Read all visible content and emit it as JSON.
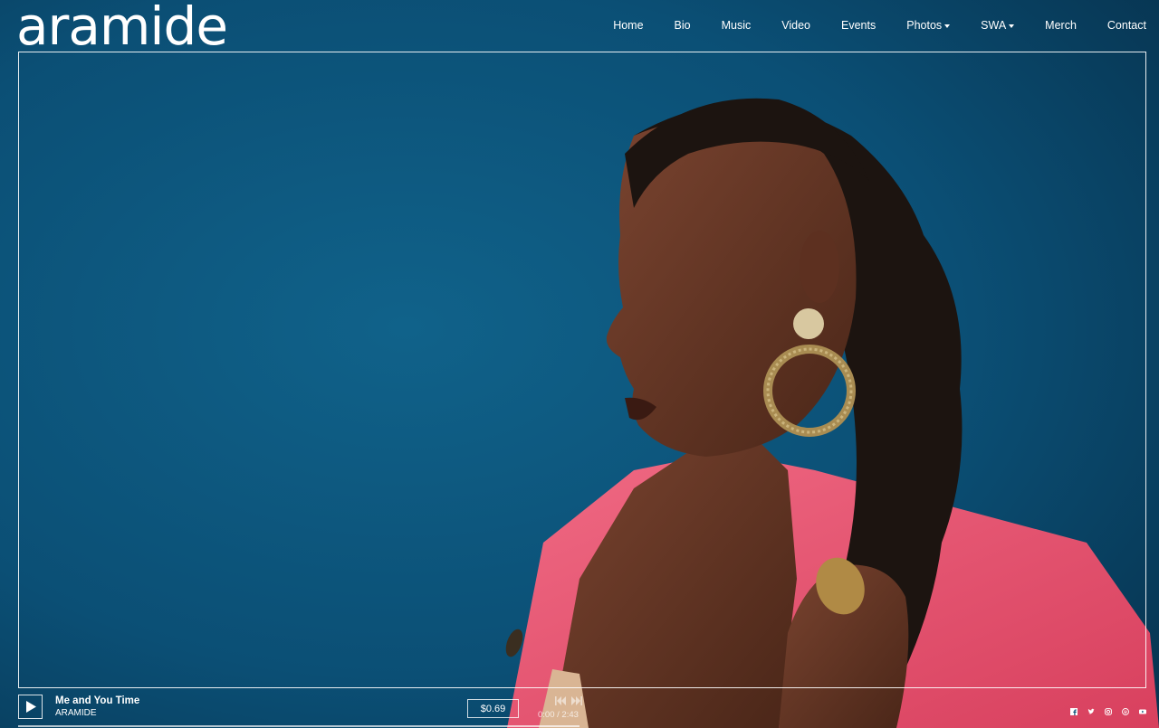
{
  "site": {
    "logo": "aramide"
  },
  "nav": {
    "items": [
      {
        "label": "Home",
        "dropdown": false
      },
      {
        "label": "Bio",
        "dropdown": false
      },
      {
        "label": "Music",
        "dropdown": false
      },
      {
        "label": "Video",
        "dropdown": false
      },
      {
        "label": "Events",
        "dropdown": false
      },
      {
        "label": "Photos",
        "dropdown": true
      },
      {
        "label": "SWA",
        "dropdown": true
      },
      {
        "label": "Merch",
        "dropdown": false
      },
      {
        "label": "Contact",
        "dropdown": false
      }
    ]
  },
  "player": {
    "track_title": "Me and You Time",
    "track_artist": "ARAMIDE",
    "price": "$0.69",
    "time_current": "0:00",
    "time_separator": " / ",
    "time_total": "2:43",
    "icons": {
      "play": "play-icon",
      "prev": "skip-back-icon",
      "next": "skip-forward-icon"
    }
  },
  "socials": [
    {
      "name": "facebook-icon"
    },
    {
      "name": "twitter-icon"
    },
    {
      "name": "instagram-icon"
    },
    {
      "name": "spotify-icon"
    },
    {
      "name": "youtube-icon"
    }
  ],
  "colors": {
    "background": "#0b4f75",
    "jacket": "#e8546f",
    "skin": "#6b3a26",
    "hair": "#1c1410",
    "earring": "#b89a5c"
  }
}
